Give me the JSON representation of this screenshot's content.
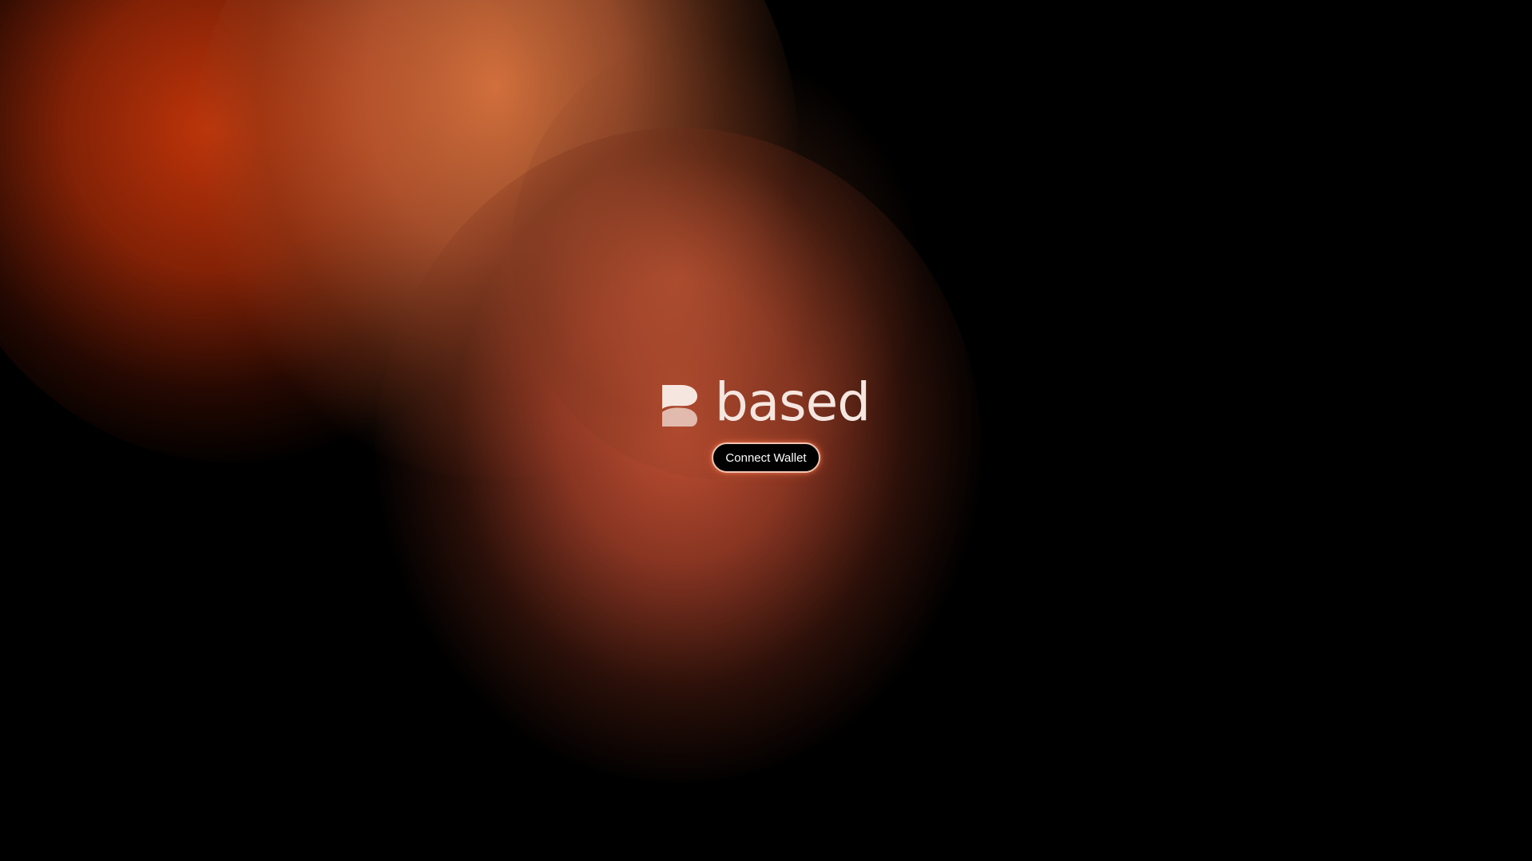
{
  "brand": {
    "name": "based",
    "logo_icon": "based-b-logo-icon",
    "logo_color": "#f6e6e0"
  },
  "actions": {
    "connect_wallet_label": "Connect Wallet"
  },
  "colors": {
    "background": "#000000",
    "glow_primary": "#c8370a",
    "glow_secondary": "#e17841",
    "button_border": "#f2c3b0"
  }
}
